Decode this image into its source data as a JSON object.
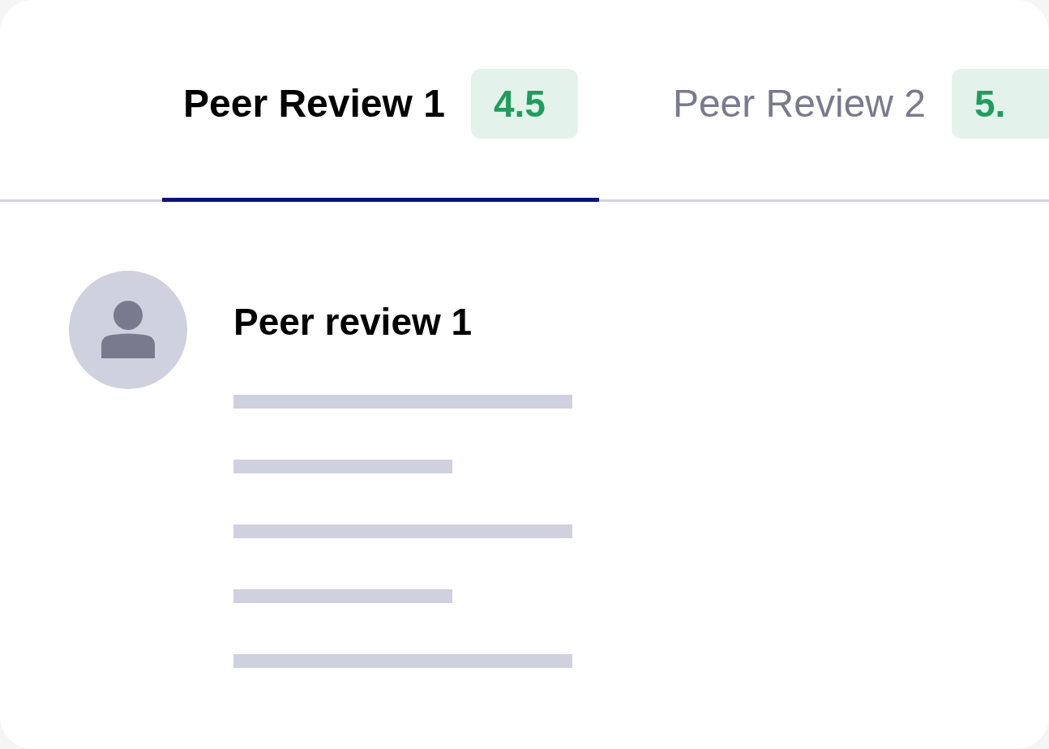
{
  "tabs": [
    {
      "label": "Peer Review 1",
      "score": "4.5",
      "selected": true
    },
    {
      "label": "Peer Review 2",
      "score": "5.",
      "selected": false
    }
  ],
  "review": {
    "title": "Peer review 1",
    "lines": [
      {
        "kind": "long"
      },
      {
        "kind": "short"
      },
      {
        "kind": "long"
      },
      {
        "kind": "short"
      },
      {
        "kind": "long"
      }
    ]
  }
}
